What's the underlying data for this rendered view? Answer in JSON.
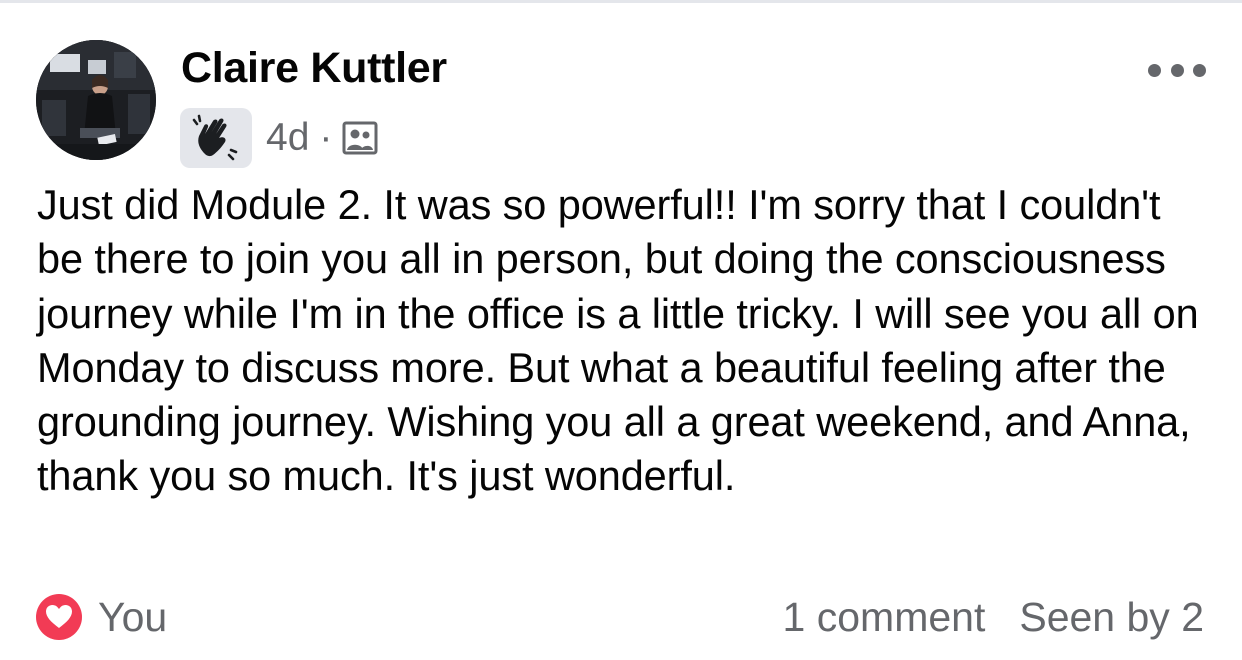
{
  "post": {
    "author": "Claire Kuttler",
    "timestamp": "4d",
    "separator": "·",
    "badge_icon": "waving-hand-icon",
    "audience_icon": "group-members-icon",
    "more_icon": "ellipsis-icon",
    "text": "Just did Module 2. It was so powerful!! I'm sorry that I couldn't be there to join you all in person, but doing the consciousness journey while I'm in the office is a little tricky. I will see you all on Monday to discuss more. But what a beautiful feeling after the grounding journey. Wishing you all a great weekend, and Anna, thank you so much. It's just wonderful."
  },
  "footer": {
    "reaction_icon": "heart-icon",
    "reaction_names": "You",
    "comments": "1 comment",
    "seen_by": "Seen by 2"
  },
  "colors": {
    "text_primary": "#050505",
    "text_secondary": "#65676b",
    "badge_bg": "#e4e6eb",
    "heart": "#f23b55"
  }
}
